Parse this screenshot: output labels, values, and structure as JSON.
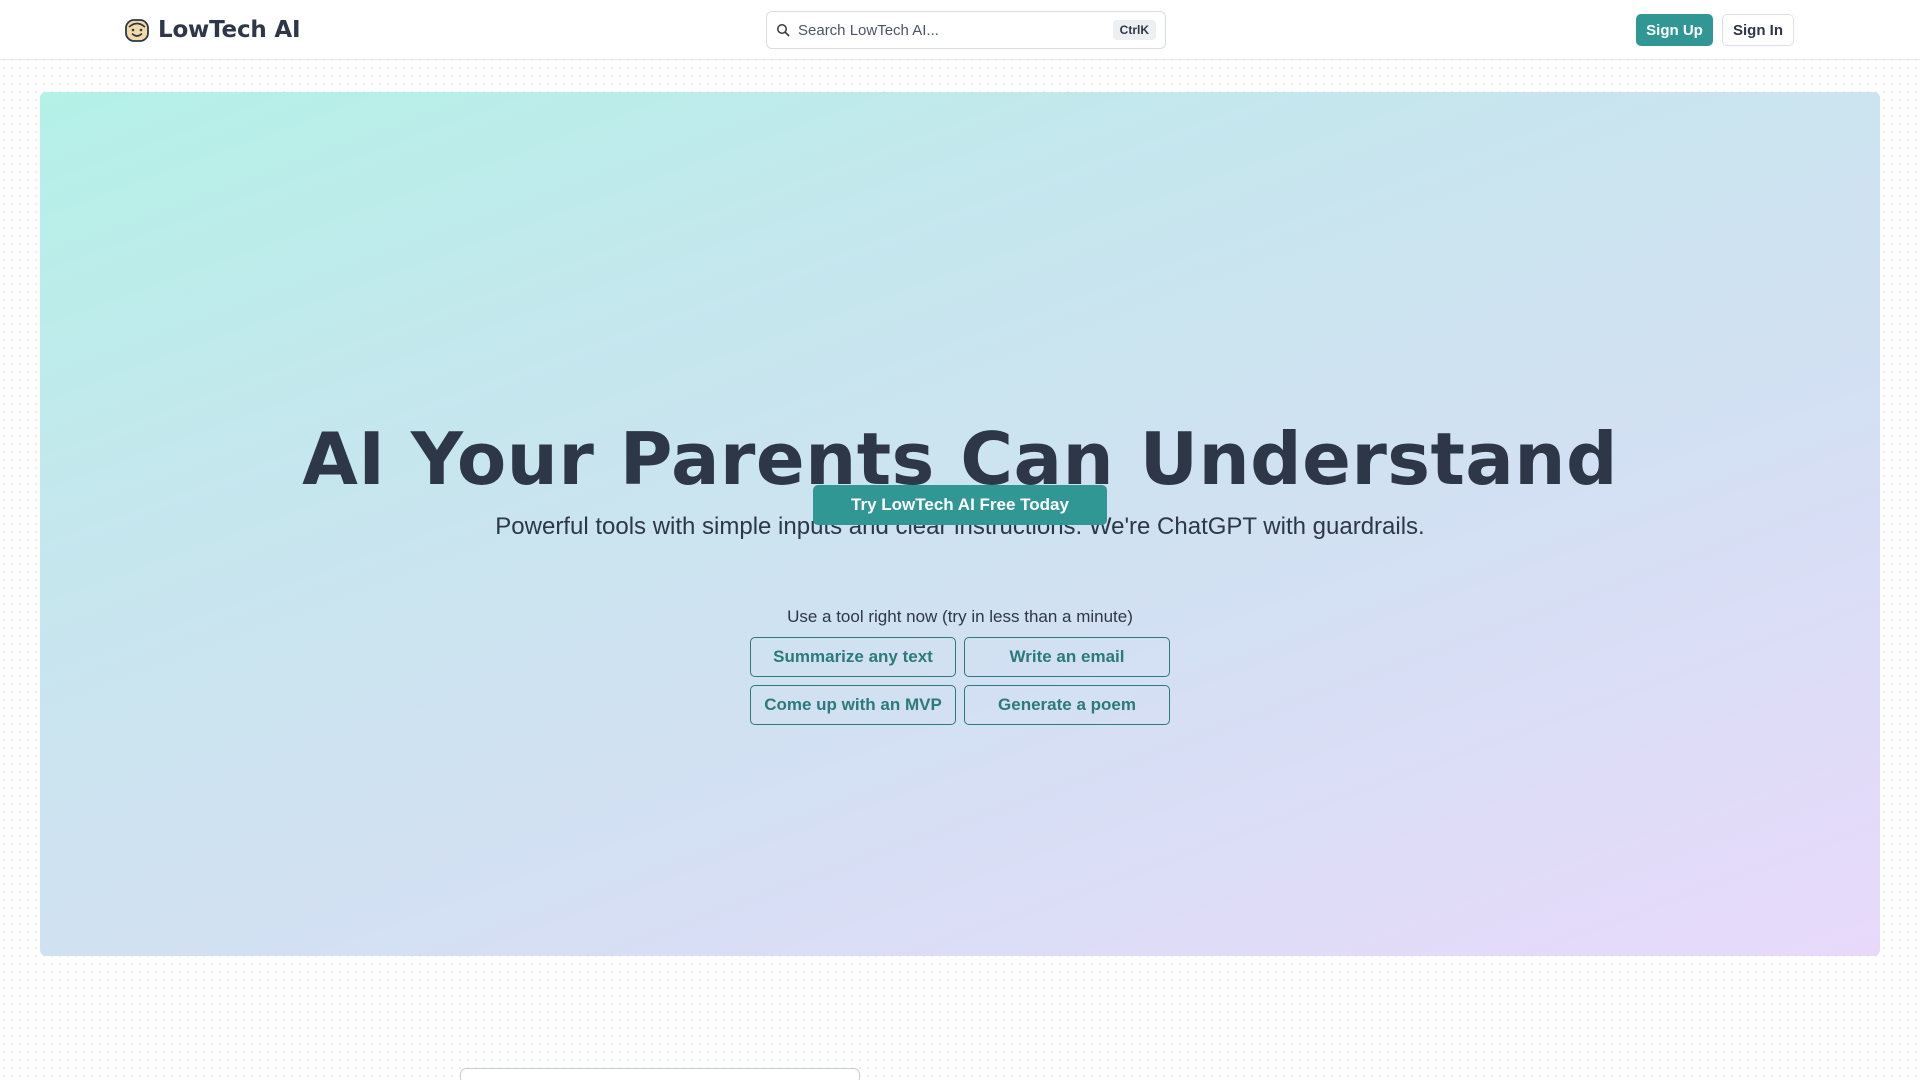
{
  "brand": {
    "name": "LowTech AI",
    "logo_icon": "smiling-face-icon"
  },
  "search": {
    "placeholder": "Search LowTech AI...",
    "value": "",
    "shortcut": "CtrlK",
    "icon": "search-icon"
  },
  "auth": {
    "signup_label": "Sign Up",
    "signin_label": "Sign In"
  },
  "hero": {
    "title": "AI Your Parents Can Understand",
    "subtitle": "Powerful tools with simple inputs and clear instructions. We're ChatGPT with guardrails.",
    "cta_label": "Try LowTech AI Free Today",
    "tools_prompt": "Use a tool right now (try in less than a minute)",
    "tools": [
      {
        "label": "Summarize any text"
      },
      {
        "label": "Write an email"
      },
      {
        "label": "Come up with an MVP"
      },
      {
        "label": "Generate a poem"
      }
    ]
  },
  "colors": {
    "accent": "#319795",
    "accent_dark": "#2c7a7b",
    "text": "#2d3748",
    "hero_gradient_start": "#b4f1e7",
    "hero_gradient_end": "#e8d9fb"
  }
}
